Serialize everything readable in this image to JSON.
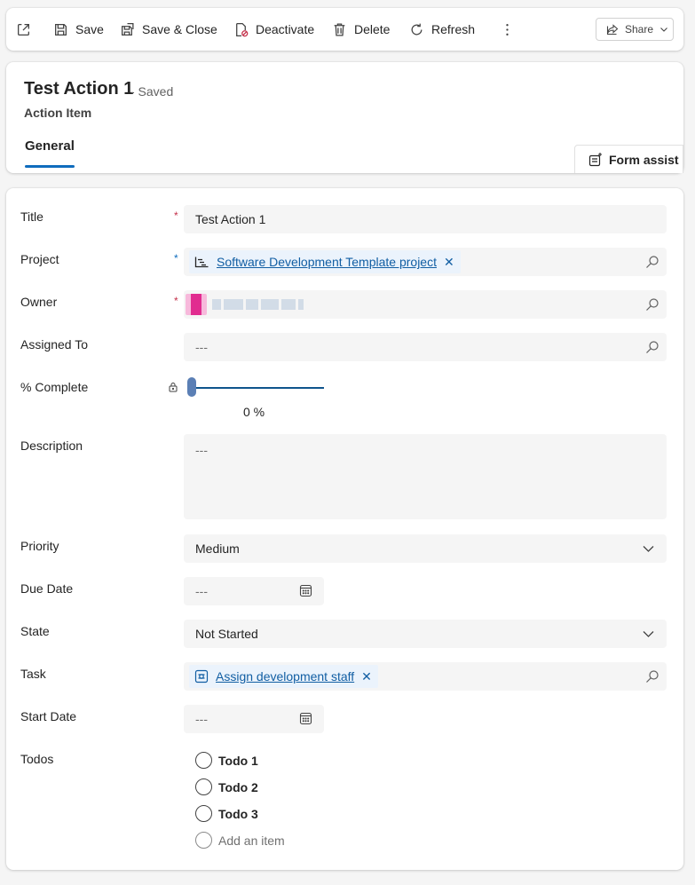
{
  "toolbar": {
    "popout_icon": "popout-icon",
    "save_label": "Save",
    "save_close_label": "Save & Close",
    "deactivate_label": "Deactivate",
    "delete_label": "Delete",
    "refresh_label": "Refresh",
    "more_icon": "more-vertical-icon",
    "share_label": "Share"
  },
  "header": {
    "title": "Test Action 1",
    "status": "- Saved",
    "entity": "Action Item",
    "tabs": [
      {
        "label": "General"
      }
    ],
    "form_assist_label": "Form assist"
  },
  "form": {
    "title": {
      "label": "Title",
      "value": "Test Action 1",
      "required": "*"
    },
    "project": {
      "label": "Project",
      "value": "Software Development Template project",
      "required": "*"
    },
    "owner": {
      "label": "Owner",
      "required": "*"
    },
    "assigned_to": {
      "label": "Assigned To",
      "placeholder": "---"
    },
    "percent_complete": {
      "label": "% Complete",
      "value": 0,
      "display": "0 %"
    },
    "description": {
      "label": "Description",
      "placeholder": "---"
    },
    "priority": {
      "label": "Priority",
      "value": "Medium"
    },
    "due_date": {
      "label": "Due Date",
      "placeholder": "---"
    },
    "state": {
      "label": "State",
      "value": "Not Started"
    },
    "task": {
      "label": "Task",
      "value": "Assign development staff"
    },
    "start_date": {
      "label": "Start Date",
      "placeholder": "---"
    },
    "todos": {
      "label": "Todos",
      "items": [
        {
          "label": "Todo 1"
        },
        {
          "label": "Todo 2"
        },
        {
          "label": "Todo 3"
        }
      ],
      "add_label": "Add an item"
    }
  },
  "colors": {
    "accent": "#0f6cbd",
    "link": "#115ea3",
    "required": "#c4314b",
    "field_bg": "#f5f5f5"
  }
}
